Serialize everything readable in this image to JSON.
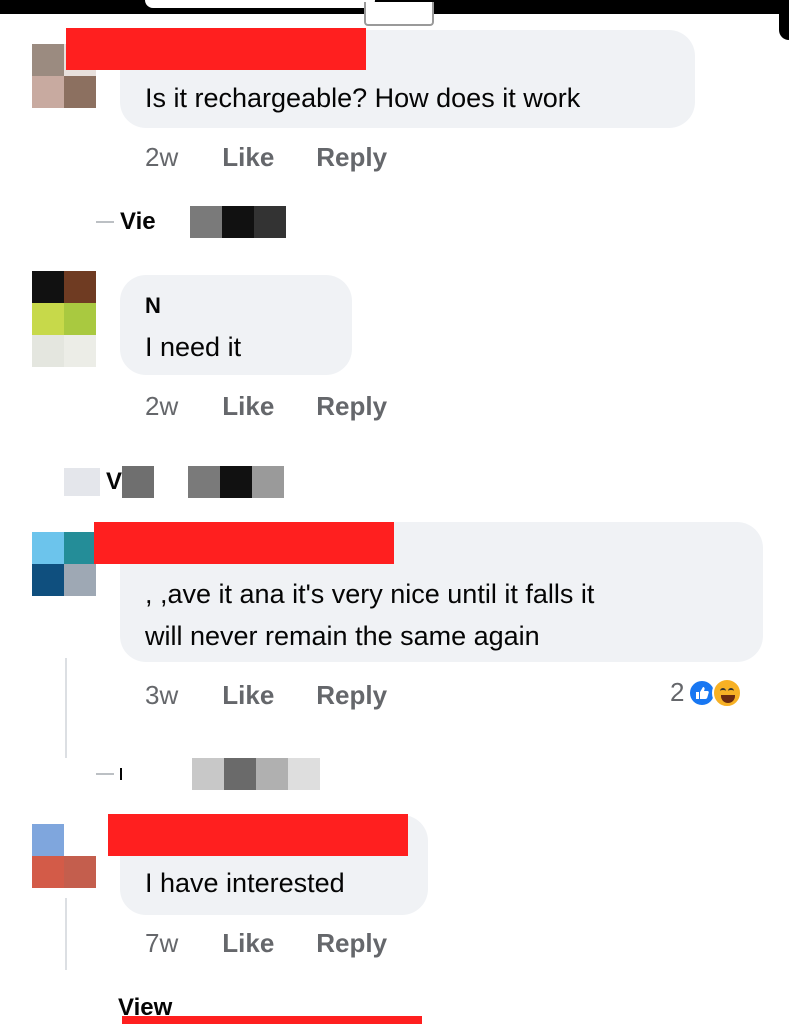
{
  "comments": [
    {
      "text_lines": [
        "Is it rechargeable? How does it work"
      ],
      "time": "2w",
      "like_label": "Like",
      "reply_label": "Reply",
      "view_replies_text": "Vie",
      "avatar_colors": [
        "#9b8b80",
        "#e8e0dc",
        "#c8aaa0",
        "#8c7060"
      ]
    },
    {
      "author_initial": "N",
      "text_lines": [
        "I need it"
      ],
      "time": "2w",
      "like_label": "Like",
      "reply_label": "Reply",
      "view_replies_text": "Vi",
      "avatar_colors": [
        "#111111",
        "#6f3b22",
        "#c7d94a",
        "#a9c940",
        "#e4e6df",
        "#ecede7"
      ]
    },
    {
      "text_lines": [
        ", ,ave it ana it's very nice until it falls it",
        "will never remain the same again"
      ],
      "time": "3w",
      "like_label": "Like",
      "reply_label": "Reply",
      "reactions": {
        "count": "2",
        "types": [
          "like-icon",
          "haha-icon"
        ]
      },
      "avatar_colors": [
        "#6cc4ec",
        "#248d98",
        "#0f4f7e",
        "#9ea8b4"
      ]
    },
    {
      "text_lines": [
        "I have interested"
      ],
      "time": "7w",
      "like_label": "Like",
      "reply_label": "Reply",
      "view_replies_text": "View",
      "avatar_colors": [
        "#7fa6dd",
        "#ffffff",
        "#d35b48",
        "#c45e4d"
      ]
    }
  ],
  "colors": {
    "bubble": "#f0f2f5",
    "meta": "#65676b",
    "redaction": "#ff1f1f",
    "like_blue": "#1877f2"
  }
}
